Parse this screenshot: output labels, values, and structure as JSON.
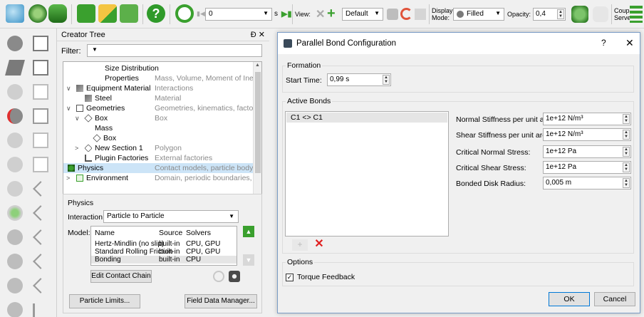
{
  "toolbar": {
    "step_value": "0",
    "step_unit": "s",
    "view_label": "View:",
    "view_preset": "Default",
    "display_mode_label": "Display\nMode:",
    "display_mode": "Filled",
    "opacity_label": "Opacity:",
    "opacity_value": "0,4",
    "coupling_label": "Coupling\nServer:"
  },
  "creator_tree": {
    "title": "Creator Tree",
    "title_buttons": "Ɖ ✕",
    "filter_label": "Filter:",
    "rows": [
      {
        "name": "Size Distribution",
        "desc": ""
      },
      {
        "name": "Properties",
        "desc": "Mass, Volume, Moment of Ine..."
      },
      {
        "name": "Equipment Material",
        "desc": "Interactions"
      },
      {
        "name": "Steel",
        "desc": "Material"
      },
      {
        "name": "Geometries",
        "desc": "Geometries, kinematics, factor..."
      },
      {
        "name": "Box",
        "desc": "Box"
      },
      {
        "name": "Mass",
        "desc": ""
      },
      {
        "name": "Box",
        "desc": ""
      },
      {
        "name": "New Section 1",
        "desc": "Polygon"
      },
      {
        "name": "Plugin Factories",
        "desc": "External factories"
      },
      {
        "name": "Physics",
        "desc": "Contact models, particle body..."
      },
      {
        "name": "Environment",
        "desc": "Domain, periodic boundaries, ..."
      }
    ]
  },
  "physics": {
    "title": "Physics",
    "interaction_label": "Interaction:",
    "interaction_value": "Particle to Particle",
    "model_label": "Model:",
    "columns": [
      "Name",
      "Source",
      "Solvers"
    ],
    "models": [
      {
        "name": "Hertz-Mindlin (no slip)",
        "source": "built-in",
        "solvers": "CPU, GPU"
      },
      {
        "name": "Standard Rolling Friction",
        "source": "built-in",
        "solvers": "CPU, GPU"
      },
      {
        "name": "Bonding",
        "source": "built-in",
        "solvers": "CPU"
      }
    ],
    "edit_chain_label": "Edit Contact Chain",
    "particle_limits_label": "Particle Limits...",
    "field_data_label": "Field Data Manager..."
  },
  "dialog": {
    "title": "Parallel Bond Configuration",
    "help": "?",
    "close": "✕",
    "formation_title": "Formation",
    "start_time_label": "Start Time:",
    "start_time_value": "0,99 s",
    "active_bonds_title": "Active Bonds",
    "bonds": [
      "C1 <> C1"
    ],
    "params": [
      {
        "label": "Normal Stiffness per unit area:",
        "value": "1e+12 N/m³"
      },
      {
        "label": "Shear Stiffness per unit area:",
        "value": "1e+12 N/m³"
      },
      {
        "label": "Critical Normal Stress:",
        "value": "1e+12 Pa"
      },
      {
        "label": "Critical Shear Stress:",
        "value": "1e+12 Pa"
      },
      {
        "label": "Bonded Disk Radius:",
        "value": "0,005 m"
      }
    ],
    "options_title": "Options",
    "torque_feedback_label": "Torque Feedback",
    "torque_feedback_checked": "✓",
    "ok_label": "OK",
    "cancel_label": "Cancel"
  },
  "colors": {
    "accent_green": "#3aa02e",
    "selection_blue": "#cce4f7",
    "delete_red": "#e02020"
  }
}
